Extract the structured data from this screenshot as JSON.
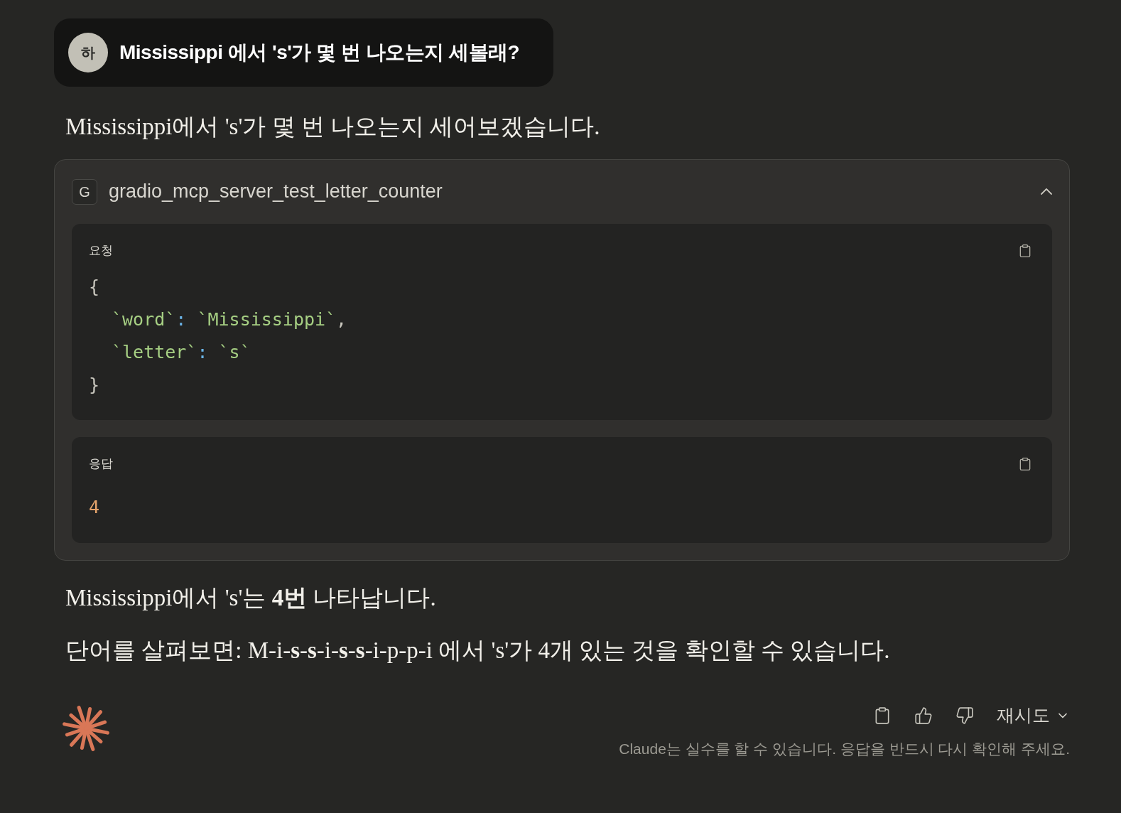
{
  "user_message": {
    "avatar": "하",
    "text": "Mississippi 에서 's'가 몇 번 나오는지 세볼래?"
  },
  "intro": "Mississippi에서 's'가 몇 번 나오는지 세어보겠습니다.",
  "tool_call": {
    "badge": "G",
    "name": "gradio_mcp_server_test_letter_counter",
    "expanded": true,
    "request": {
      "label": "요청",
      "lines": [
        {
          "indented": false,
          "tokens": [
            {
              "kind": "punct",
              "text": "{"
            }
          ]
        },
        {
          "indented": true,
          "tokens": [
            {
              "kind": "string",
              "text": "`word`"
            },
            {
              "kind": "colon",
              "text": ":"
            },
            {
              "kind": "string",
              "text": "`Mississippi`"
            },
            {
              "kind": "punct",
              "text": ","
            }
          ]
        },
        {
          "indented": true,
          "tokens": [
            {
              "kind": "string",
              "text": "`letter`"
            },
            {
              "kind": "colon",
              "text": ":"
            },
            {
              "kind": "string",
              "text": "`s`"
            }
          ]
        },
        {
          "indented": false,
          "tokens": [
            {
              "kind": "punct",
              "text": "}"
            }
          ]
        }
      ]
    },
    "response": {
      "label": "응답",
      "value": "4"
    }
  },
  "answer": [
    "Mississippi에서 's'는 **4번** 나타납니다.",
    "단어를 살펴보면: M-i-**s**-**s**-i-**s**-**s**-i-p-p-i 에서 's'가 4개 있는 것을 확인할 수 있습니다."
  ],
  "actions": {
    "retry": "재시도"
  },
  "disclaimer": "Claude는 실수를 할 수 있습니다. 응답을 반드시 다시 확인해 주세요."
}
